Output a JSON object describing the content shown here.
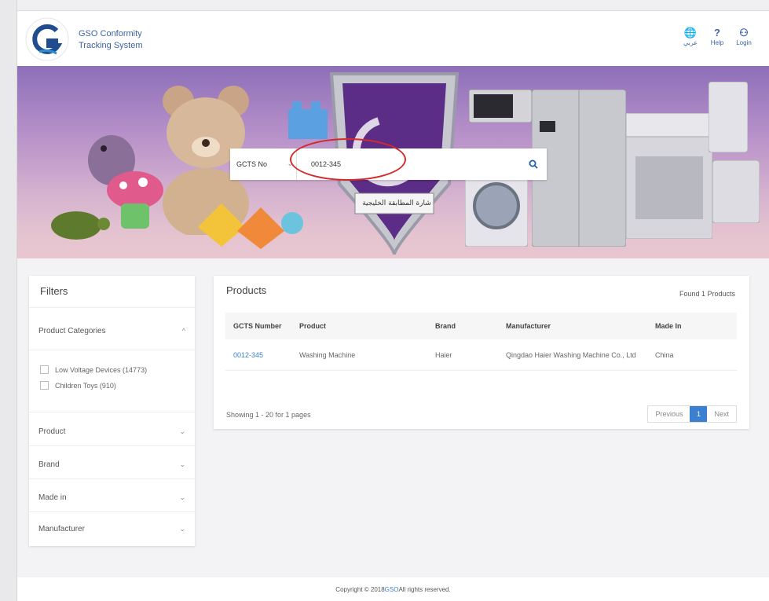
{
  "header": {
    "brand_line1": "GSO Conformity",
    "brand_line2": "Tracking System",
    "actions": [
      {
        "label": "عربي",
        "icon": "globe-icon",
        "glyph": "🌐"
      },
      {
        "label": "Help",
        "icon": "question-icon",
        "glyph": "?"
      },
      {
        "label": "Login",
        "icon": "user-icon",
        "glyph": "⚇"
      }
    ]
  },
  "hero": {
    "banner_text": "شارة المطابقة الخليجية"
  },
  "search": {
    "type_label": "GCTS No",
    "caret": "⌄",
    "value": "0012-345",
    "button_glyph": "⚲"
  },
  "filters": {
    "title": "Filters",
    "product_categories": {
      "label": "Product Categories",
      "chevron": "^",
      "options": [
        {
          "label": "Low Voltage Devices (14773)"
        },
        {
          "label": "Children Toys (910)"
        }
      ]
    },
    "groups": [
      {
        "label": "Product",
        "chevron": "⌄"
      },
      {
        "label": "Brand",
        "chevron": "⌄"
      },
      {
        "label": "Made in",
        "chevron": "⌄"
      },
      {
        "label": "Manufacturer",
        "chevron": "⌄"
      }
    ]
  },
  "products": {
    "title": "Products",
    "found": "Found 1 Products",
    "columns": [
      "GCTS Number",
      "Product",
      "Brand",
      "Manufacturer",
      "Made In"
    ],
    "rows": [
      {
        "gcts": "0012-345",
        "product": "Washing Machine",
        "brand": "Haier",
        "manufacturer": "Qingdao Haier Washing Machine Co., Ltd",
        "made_in": "China"
      }
    ],
    "showing": "Showing 1 - 20 for 1 pages",
    "pagination": {
      "previous": "Previous",
      "current": "1",
      "next": "Next"
    }
  },
  "footer": {
    "prefix": "Copyright © 2018 ",
    "org": "GSO",
    "suffix": " All rights reserved."
  },
  "colors": {
    "brand_blue": "#3c63a3",
    "link_blue": "#3a7fd0",
    "highlight_red": "#d42a2a"
  }
}
